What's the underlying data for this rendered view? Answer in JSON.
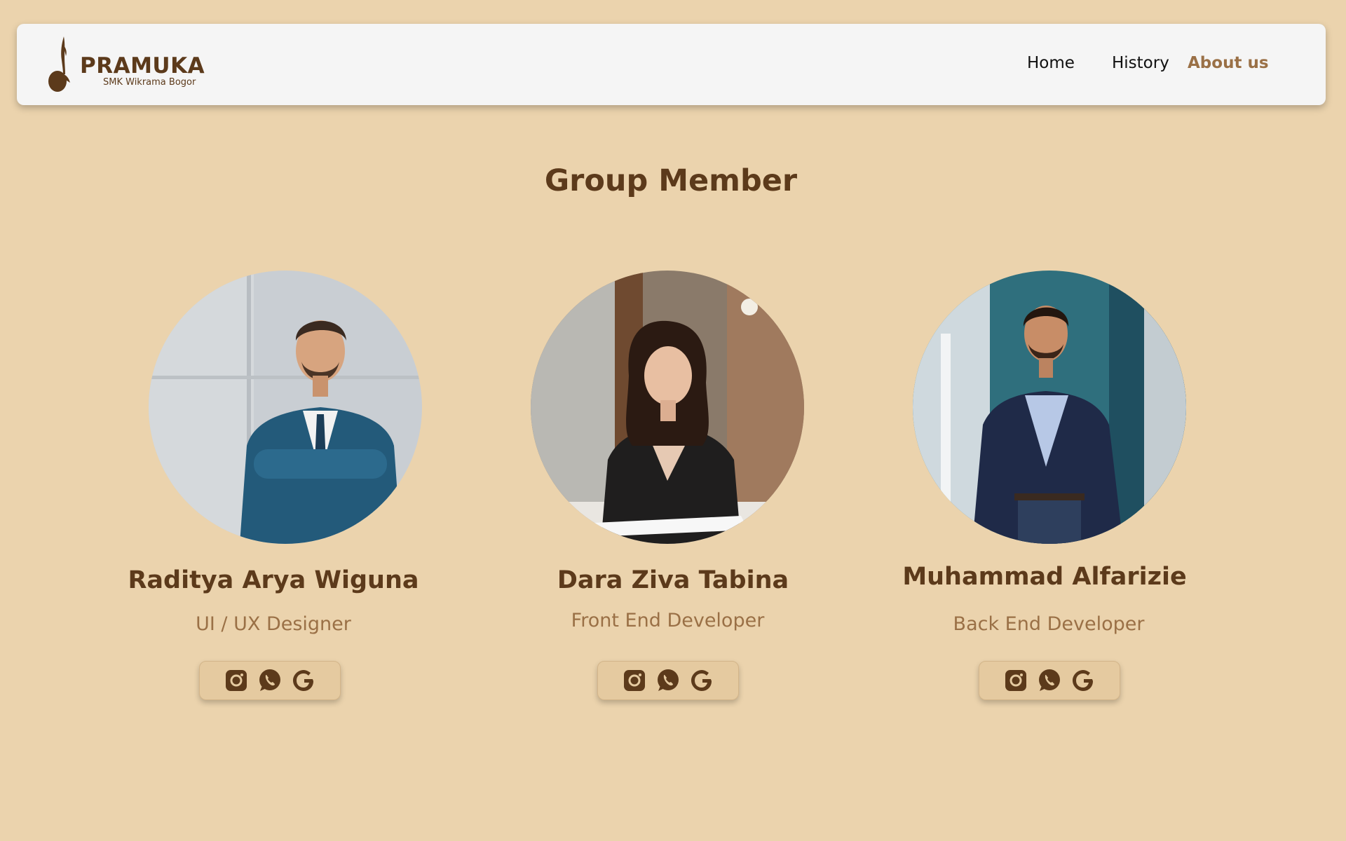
{
  "header": {
    "brand_name": "PRAMUKA",
    "brand_subtitle": "SMK Wikrama Bogor",
    "nav": [
      {
        "label": "Home",
        "active": false
      },
      {
        "label": "History",
        "active": false
      },
      {
        "label": "About us",
        "active": true
      }
    ]
  },
  "main": {
    "title": "Group Member",
    "members": [
      {
        "name": "Raditya Arya Wiguna",
        "role": "UI / UX Designer",
        "photo": "man-in-teal-suit-arms-crossed"
      },
      {
        "name": "Dara Ziva Tabina",
        "role": "Front End Developer",
        "photo": "woman-at-desk-writing"
      },
      {
        "name": "Muhammad Alfarizie",
        "role": "Back End Developer",
        "photo": "man-in-navy-blazer"
      }
    ],
    "social_icons": [
      "instagram-icon",
      "whatsapp-icon",
      "google-icon"
    ]
  },
  "colors": {
    "background": "#ebd3ad",
    "navbar": "#f5f5f5",
    "primary_brown": "#5c3a1b",
    "accent_brown": "#9a7046",
    "social_box": "#e5caa0"
  }
}
